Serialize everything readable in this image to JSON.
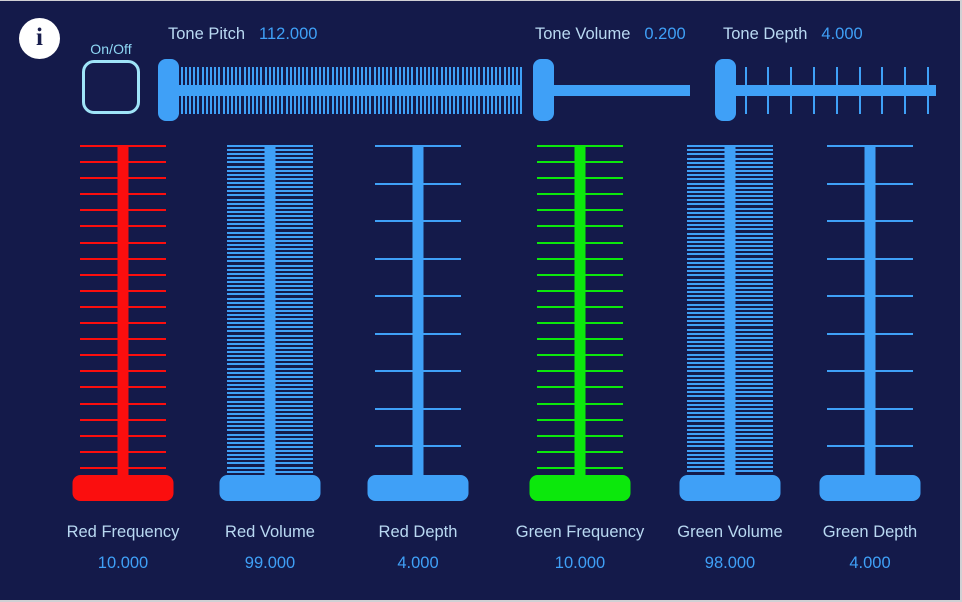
{
  "app": {
    "background_color": "#141a4a",
    "accent_color": "#3fa0f7",
    "label_color": "#b9d9f2",
    "red_color": "#fb0e0e",
    "green_color": "#0ce80c",
    "outline_color": "#9fe4f8"
  },
  "info_button": {
    "icon": "info-icon",
    "glyph": "i"
  },
  "onoff": {
    "label": "On/Off",
    "state": "off"
  },
  "header_controls": [
    {
      "key": "tone_pitch",
      "name": "Tone Pitch",
      "value": "112.000",
      "numeric": 112.0,
      "tick_count": 83,
      "track_length": 348
    },
    {
      "key": "tone_volume",
      "name": "Tone Volume",
      "value": "0.200",
      "numeric": 0.2,
      "tick_count": 0,
      "track_length": 141
    },
    {
      "key": "tone_depth",
      "name": "Tone Depth",
      "value": "4.000",
      "numeric": 4.0,
      "tick_count": 9,
      "track_length": 205
    }
  ],
  "vertical_controls": [
    {
      "key": "red_frequency",
      "name": "Red Frequency",
      "value": "10.000",
      "numeric": 10.0,
      "color": "#fb0e0e",
      "tick_count": 21
    },
    {
      "key": "red_volume",
      "name": "Red Volume",
      "value": "99.000",
      "numeric": 99.0,
      "color": "#3fa0f7",
      "tick_count": 82
    },
    {
      "key": "red_depth",
      "name": "Red Depth",
      "value": "4.000",
      "numeric": 4.0,
      "color": "#3fa0f7",
      "tick_count": 9
    },
    {
      "key": "green_frequency",
      "name": "Green Frequency",
      "value": "10.000",
      "numeric": 10.0,
      "color": "#0ce80c",
      "tick_count": 21
    },
    {
      "key": "green_volume",
      "name": "Green Volume",
      "value": "98.000",
      "numeric": 98.0,
      "color": "#3fa0f7",
      "tick_count": 81
    },
    {
      "key": "green_depth",
      "name": "Green Depth",
      "value": "4.000",
      "numeric": 4.0,
      "color": "#3fa0f7",
      "tick_count": 9
    }
  ]
}
